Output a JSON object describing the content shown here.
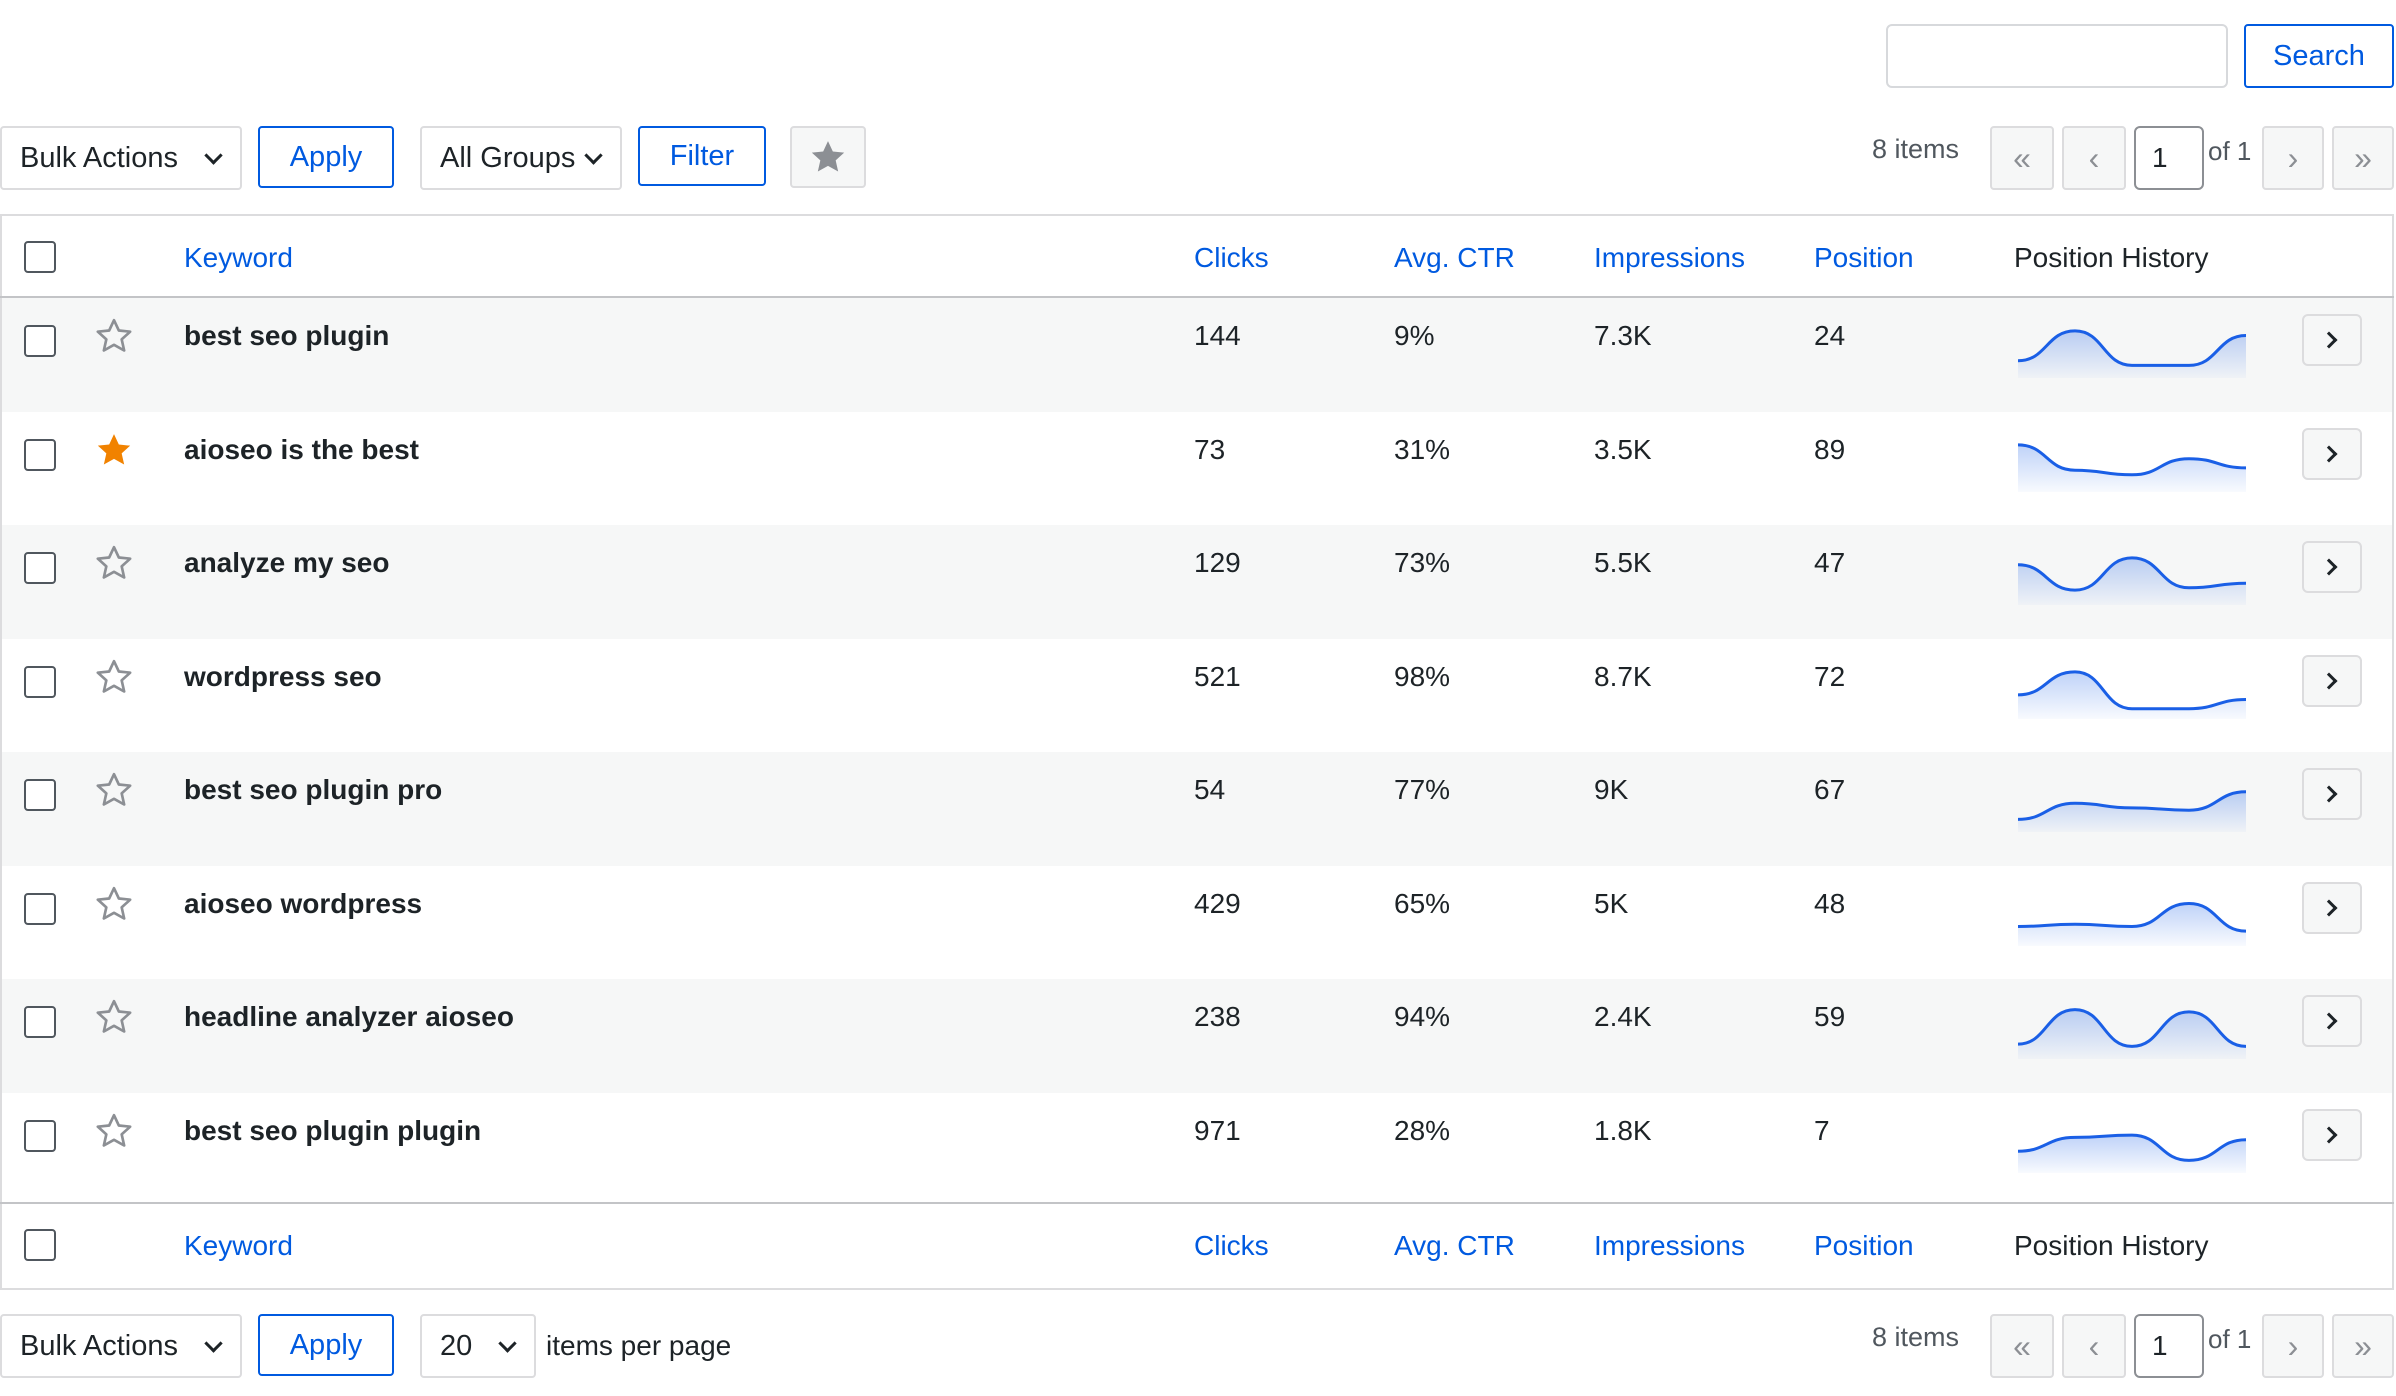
{
  "search": {
    "placeholder": "",
    "button_label": "Search"
  },
  "toolbar_top": {
    "bulk_actions_label": "Bulk Actions",
    "apply_label": "Apply",
    "groups_label": "All Groups",
    "filter_label": "Filter",
    "items_count": "8 items",
    "first_label": "«",
    "prev_label": "‹",
    "current_page": "1",
    "of_pages": "of 1",
    "next_label": "›",
    "last_label": "»"
  },
  "columns": {
    "keyword": "Keyword",
    "clicks": "Clicks",
    "ctr": "Avg. CTR",
    "impressions": "Impressions",
    "position": "Position",
    "history": "Position History"
  },
  "rows": [
    {
      "keyword": "best seo plugin",
      "clicks": "144",
      "ctr": "9%",
      "impressions": "7.3K",
      "position": "24",
      "starred": false,
      "history": [
        0.8,
        0.15,
        0.9,
        0.9,
        0.25
      ]
    },
    {
      "keyword": "aioseo is the best",
      "clicks": "73",
      "ctr": "31%",
      "impressions": "3.5K",
      "position": "89",
      "starred": true,
      "history": [
        0.15,
        0.7,
        0.8,
        0.45,
        0.65
      ]
    },
    {
      "keyword": "analyze my seo",
      "clicks": "129",
      "ctr": "73%",
      "impressions": "5.5K",
      "position": "47",
      "starred": false,
      "history": [
        0.3,
        0.85,
        0.15,
        0.8,
        0.7
      ]
    },
    {
      "keyword": "wordpress seo",
      "clicks": "521",
      "ctr": "98%",
      "impressions": "8.7K",
      "position": "72",
      "starred": false,
      "history": [
        0.65,
        0.15,
        0.95,
        0.95,
        0.75
      ]
    },
    {
      "keyword": "best seo plugin pro",
      "clicks": "54",
      "ctr": "77%",
      "impressions": "9K",
      "position": "67",
      "starred": false,
      "history": [
        0.9,
        0.55,
        0.65,
        0.7,
        0.3
      ]
    },
    {
      "keyword": "aioseo wordpress",
      "clicks": "429",
      "ctr": "65%",
      "impressions": "5K",
      "position": "48",
      "starred": false,
      "history": [
        0.75,
        0.7,
        0.75,
        0.25,
        0.85
      ]
    },
    {
      "keyword": "headline analyzer aioseo",
      "clicks": "238",
      "ctr": "94%",
      "impressions": "2.4K",
      "position": "59",
      "starred": false,
      "history": [
        0.85,
        0.1,
        0.9,
        0.15,
        0.9
      ]
    },
    {
      "keyword": "best seo plugin plugin",
      "clicks": "971",
      "ctr": "28%",
      "impressions": "1.8K",
      "position": "7",
      "starred": false,
      "history": [
        0.7,
        0.4,
        0.35,
        0.9,
        0.45
      ]
    }
  ],
  "toolbar_bottom": {
    "bulk_actions_label": "Bulk Actions",
    "apply_label": "Apply",
    "per_page_value": "20",
    "per_page_label": "items per page",
    "items_count": "8 items",
    "first_label": "«",
    "prev_label": "‹",
    "current_page": "1",
    "of_pages": "of 1",
    "next_label": "›",
    "last_label": "»"
  },
  "colors": {
    "accent": "#005ae0",
    "star_active": "#f18200",
    "star_inactive": "#8c8f94",
    "row_alt": "#f6f7f7",
    "spark_line": "#1a5fe6"
  }
}
